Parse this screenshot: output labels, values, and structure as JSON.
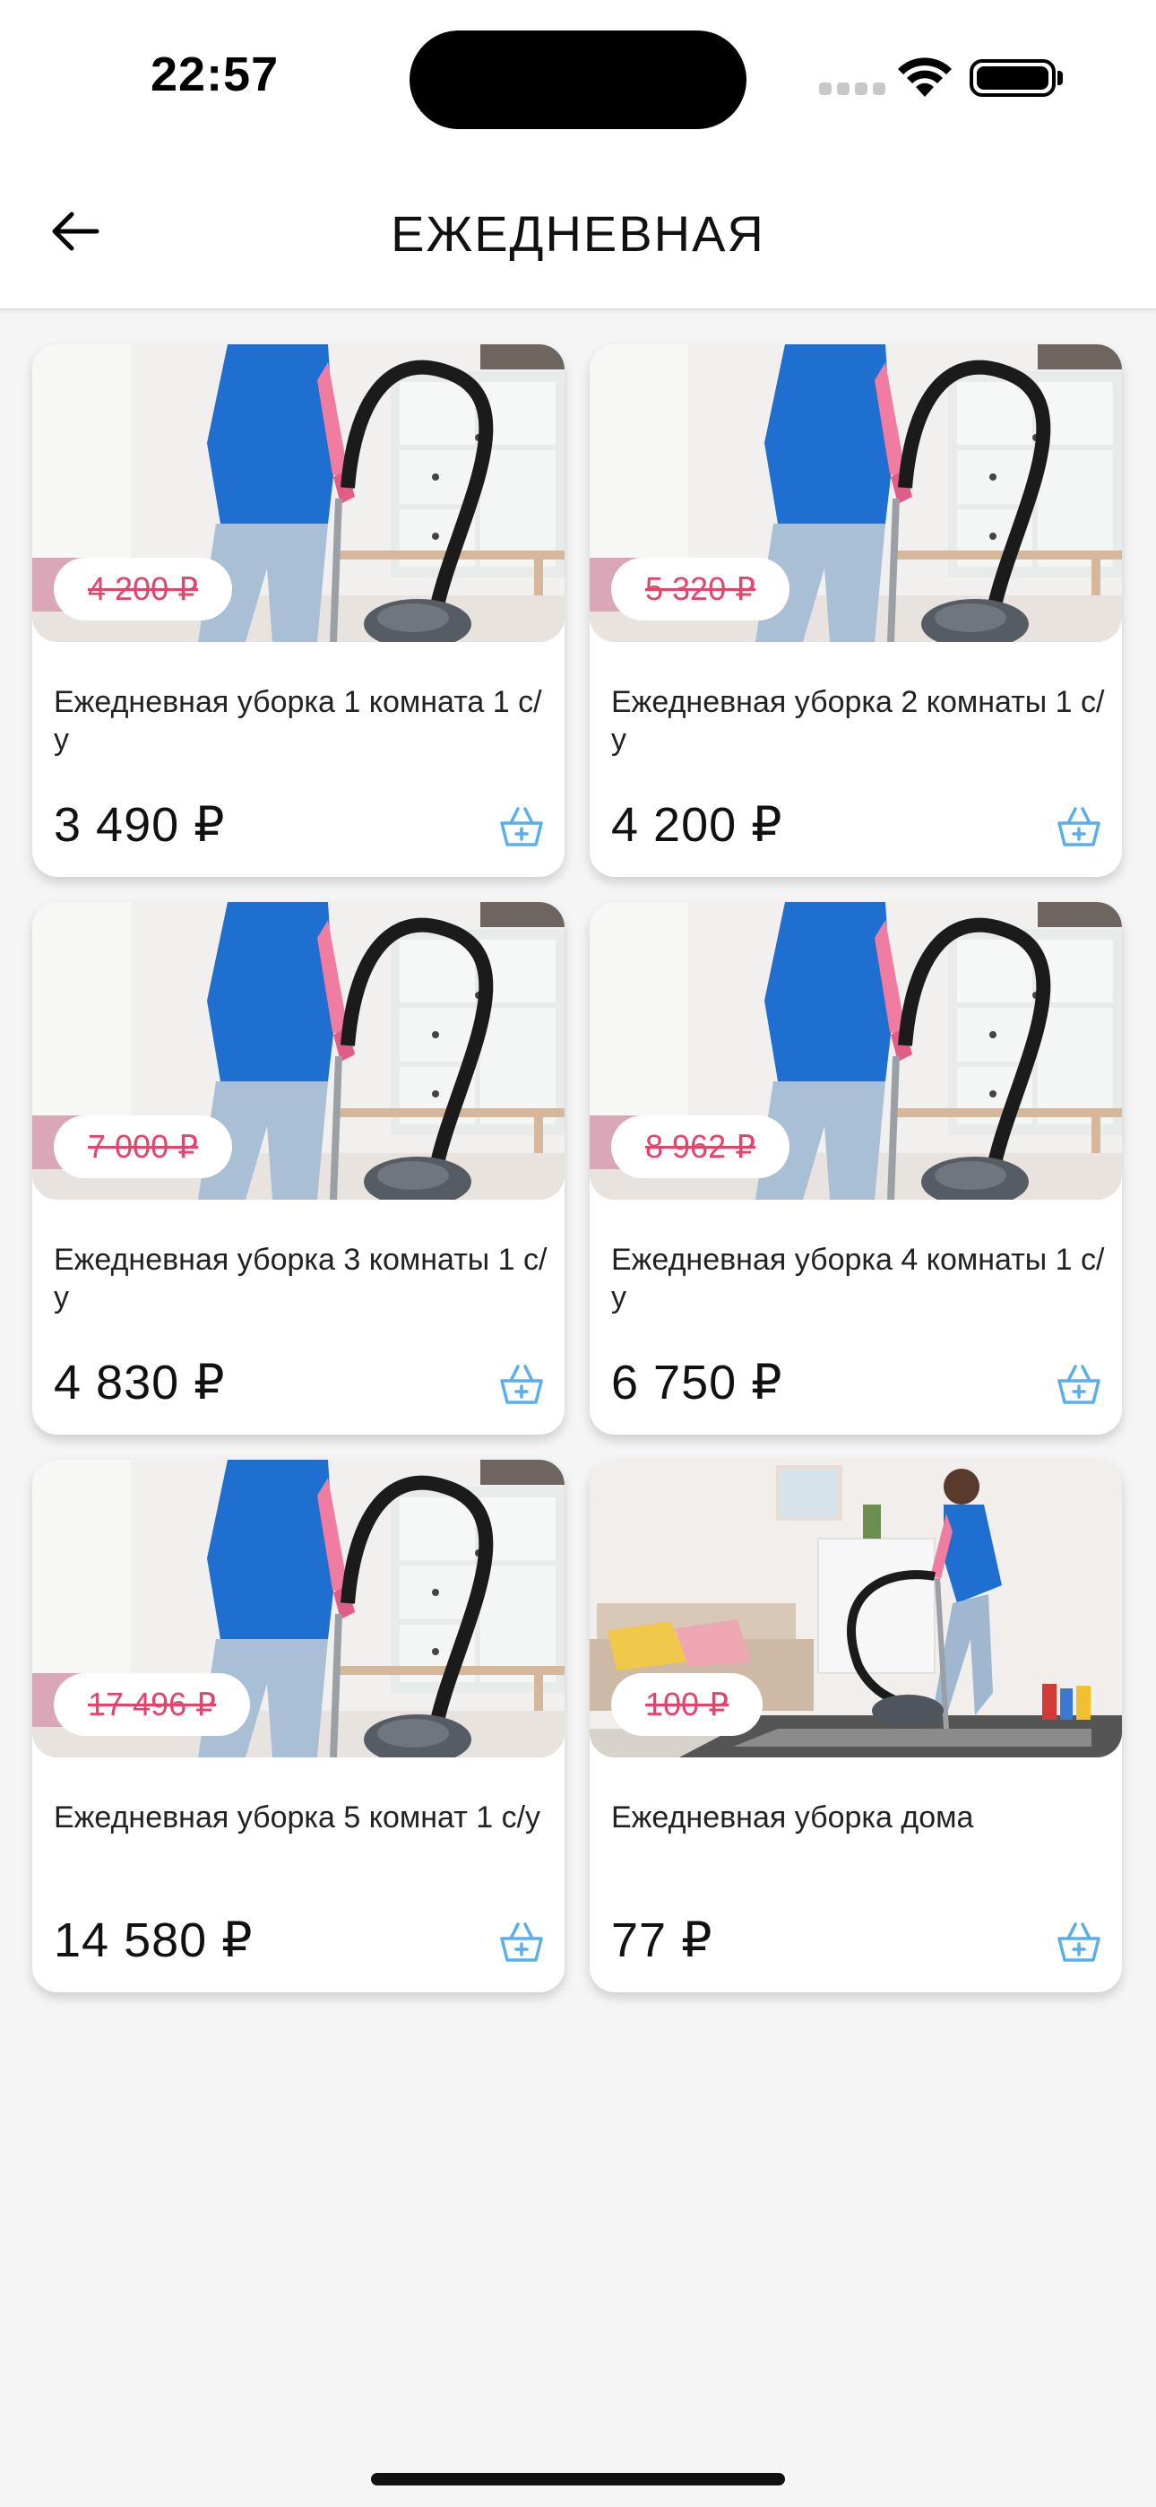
{
  "status_bar": {
    "time": "22:57"
  },
  "header": {
    "title": "ЕЖЕДНЕВНАЯ"
  },
  "products": [
    {
      "title": "Ежедневная уборка 1 комната 1 с/у",
      "old_price": "4 200 ₽",
      "price": "3 490 ₽",
      "image": "woman-vacuum-closeup"
    },
    {
      "title": "Ежедневная уборка 2 комнаты 1 с/у",
      "old_price": "5 320 ₽",
      "price": "4 200 ₽",
      "image": "woman-vacuum-closeup"
    },
    {
      "title": "Ежедневная уборка 3 комнаты 1 с/у",
      "old_price": "7 000 ₽",
      "price": "4 830 ₽",
      "image": "woman-vacuum-closeup"
    },
    {
      "title": "Ежедневная уборка 4 комнаты 1 с/у",
      "old_price": "8 962 ₽",
      "price": "6 750 ₽",
      "image": "woman-vacuum-closeup"
    },
    {
      "title": "Ежедневная уборка 5 комнат 1 с/у",
      "old_price": "17 496 ₽",
      "price": "14 580 ₽",
      "image": "woman-vacuum-closeup"
    },
    {
      "title": "Ежедневная уборка дома",
      "old_price": "100 ₽",
      "price": "77 ₽",
      "image": "woman-vacuum-living-room"
    }
  ],
  "colors": {
    "old_price": "#e0456b",
    "cart_icon": "#5aaeea",
    "background": "#f5f5f5"
  },
  "icons": [
    "back-arrow-icon",
    "basket-add-icon",
    "wifi-icon",
    "battery-icon",
    "signal-icon"
  ]
}
